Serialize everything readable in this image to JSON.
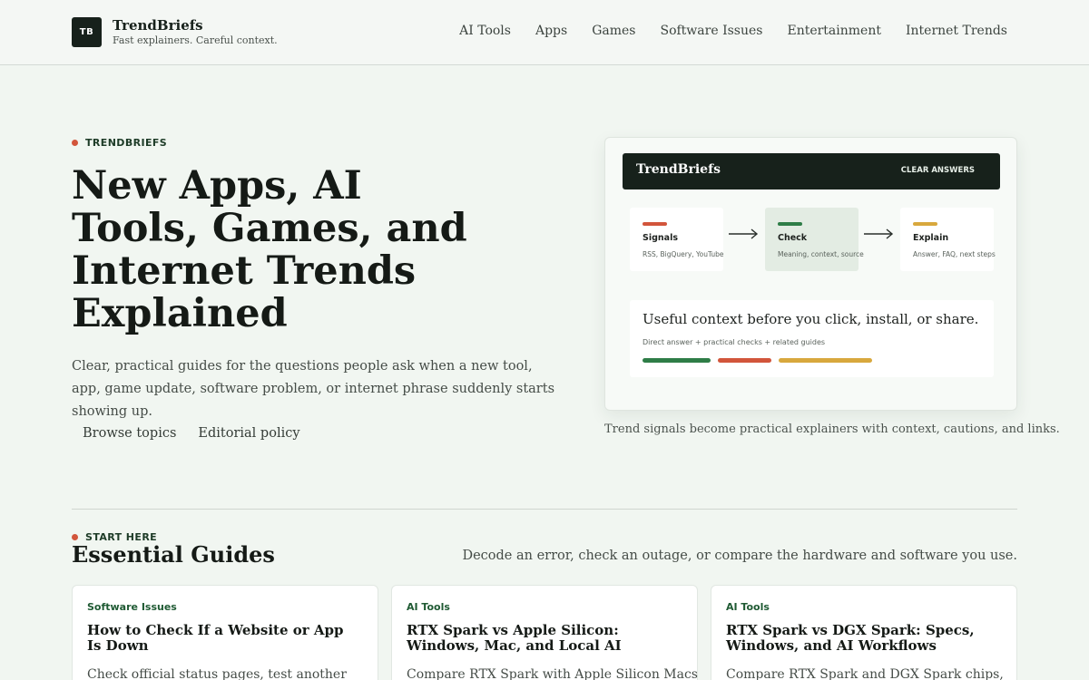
{
  "header": {
    "logo_text": "TB",
    "brand_name": "TrendBriefs",
    "tagline": "Fast explainers. Careful context.",
    "nav": [
      "AI Tools",
      "Apps",
      "Games",
      "Software Issues",
      "Entertainment",
      "Internet Trends"
    ]
  },
  "hero": {
    "eyebrow": "TRENDBRIEFS",
    "title": "New Apps, AI Tools, Games, and Internet Trends Explained",
    "description": "Clear, practical guides for the questions people ask when a new tool, app, game update, software problem, or internet phrase suddenly starts showing up.",
    "links": [
      "Browse topics",
      "Editorial policy"
    ]
  },
  "illustration": {
    "bar_title": "TrendBriefs",
    "bar_badge": "CLEAR ANSWERS",
    "steps": [
      {
        "title": "Signals",
        "sub": "RSS, BigQuery, YouTube",
        "color": "#d2553b"
      },
      {
        "title": "Check",
        "sub": "Meaning, context, source",
        "color": "#2e7d47"
      },
      {
        "title": "Explain",
        "sub": "Answer, FAQ, next steps",
        "color": "#d8a83d"
      }
    ],
    "context_title": "Useful context before you click, install, or share.",
    "context_sub": "Direct answer + practical checks + related guides",
    "context_bars": [
      "#2e7d47",
      "#d2553b",
      "#d8a83d"
    ],
    "caption": "Trend signals become practical explainers with context, cautions, and links."
  },
  "section": {
    "eyebrow": "START HERE",
    "title": "Essential Guides",
    "subtitle": "Decode an error, check an outage, or compare the hardware and software you use.",
    "cards": [
      {
        "category": "Software Issues",
        "title": "How to Check If a Website or App Is Down",
        "excerpt": "Check official status pages, test another"
      },
      {
        "category": "AI Tools",
        "title": "RTX Spark vs Apple Silicon: Windows, Mac, and Local AI",
        "excerpt": "Compare RTX Spark with Apple Silicon Macs"
      },
      {
        "category": "AI Tools",
        "title": "RTX Spark vs DGX Spark: Specs, Windows, and AI Workflows",
        "excerpt": "Compare RTX Spark and DGX Spark chips,"
      }
    ]
  },
  "colors": {
    "accent_red": "#d2553b",
    "accent_green": "#2e7d47",
    "accent_yellow": "#d8a83d",
    "dark": "#17211b",
    "background": "#f1f6f1"
  }
}
